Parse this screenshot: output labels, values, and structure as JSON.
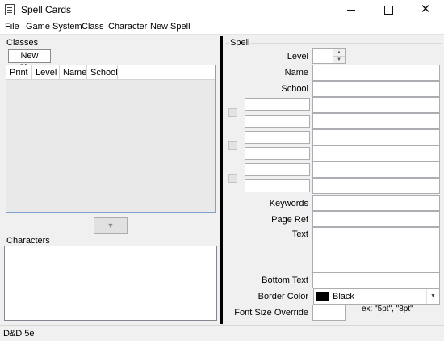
{
  "window": {
    "title": "Spell Cards",
    "app_icon": "document-icon",
    "controls": {
      "minimize": "minimize-icon",
      "maximize": "maximize-icon",
      "close": "✕"
    }
  },
  "menu": [
    "File",
    "Game System",
    "Class",
    "Character",
    "New Spell"
  ],
  "classes": {
    "label": "Classes",
    "tabs": [
      "New Class"
    ],
    "grid_columns": [
      "Print",
      "Level",
      "Name",
      "School"
    ],
    "rows": []
  },
  "move_button": {
    "icon": "▼",
    "icon_name": "down-arrow-icon"
  },
  "characters": {
    "label": "Characters",
    "items": []
  },
  "spell": {
    "label": "Spell",
    "level_label": "Level",
    "level_value": "",
    "spin_up": "▲",
    "spin_down": "▼",
    "name_label": "Name",
    "name_value": "",
    "school_label": "School",
    "school_value": "",
    "keywords_label": "Keywords",
    "keywords_value": "",
    "page_ref_label": "Page Ref",
    "page_ref_value": "",
    "text_label": "Text",
    "text_value": "",
    "bottom_text_label": "Bottom Text",
    "bottom_text_value": "",
    "border_color_label": "Border Color",
    "border_color_value": "Black",
    "border_color_swatch": "#000000",
    "font_size_label": "Font Size Override",
    "font_size_value": "",
    "font_size_hint": "ex: \"5pt\", \"8pt\""
  },
  "status": {
    "text": "D&D 5e"
  },
  "colors": {
    "splitter": "#000000",
    "grid_border": "#7da2ce",
    "grid_background": "#e9e9e9"
  }
}
